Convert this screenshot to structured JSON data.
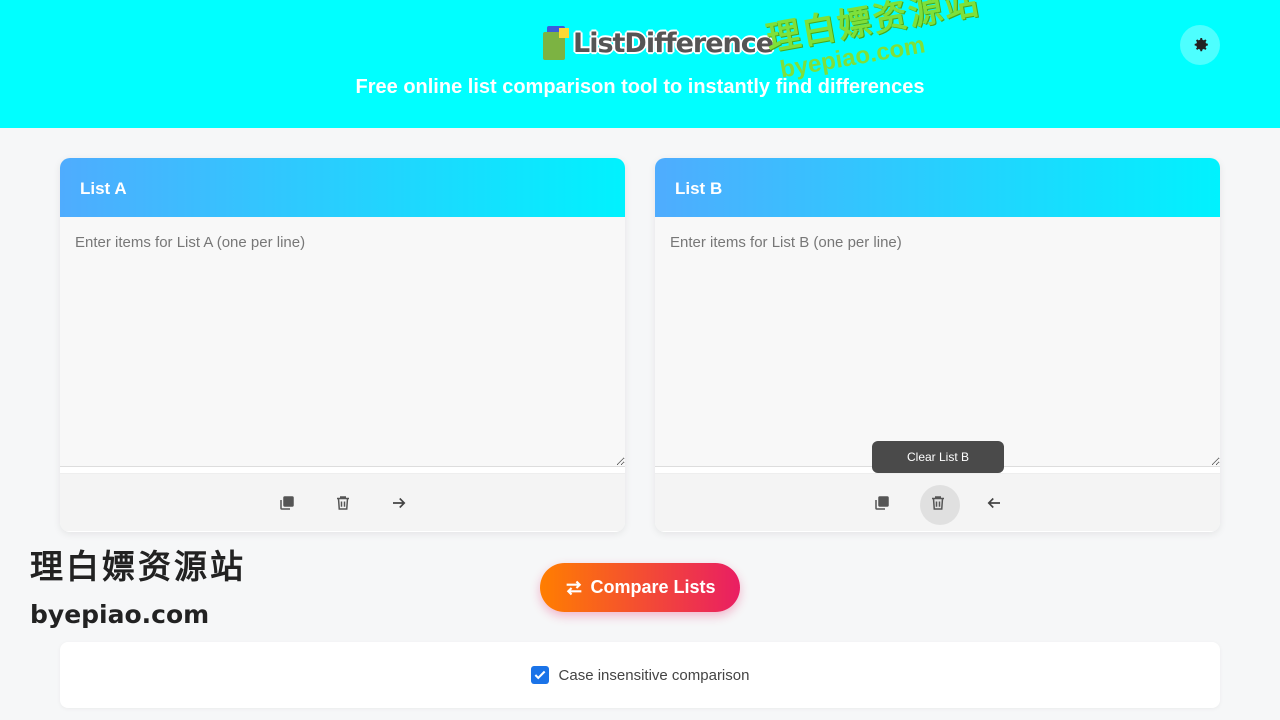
{
  "header": {
    "logo_text": "ListDifference",
    "tagline": "Free online list comparison tool to instantly find differences",
    "theme_icon": "gear-icon"
  },
  "watermark": {
    "chinese": "理白嫖资源站",
    "domain": "byepiao.com"
  },
  "list_a": {
    "title": "List A",
    "placeholder": "Enter items for List A (one per line)",
    "value": "",
    "icons": [
      "copy-icon",
      "trash-icon",
      "arrow-right-icon"
    ]
  },
  "list_b": {
    "title": "List B",
    "placeholder": "Enter items for List B (one per line)",
    "value": "",
    "icons": [
      "copy-icon",
      "trash-icon",
      "arrow-left-icon"
    ]
  },
  "tooltip": {
    "text": "Clear List B"
  },
  "compare": {
    "label": "Compare Lists",
    "icon": "swap-icon"
  },
  "options": {
    "case_insensitive_label": "Case insensitive comparison",
    "case_insensitive_checked": true
  },
  "colors": {
    "header_bg": "#00ffff",
    "panel_gradient_start": "#4facfe",
    "panel_gradient_end": "#00f2fe",
    "button_gradient_start": "#ff7e00",
    "button_gradient_end": "#e91e63",
    "checkbox": "#1a73e8"
  }
}
